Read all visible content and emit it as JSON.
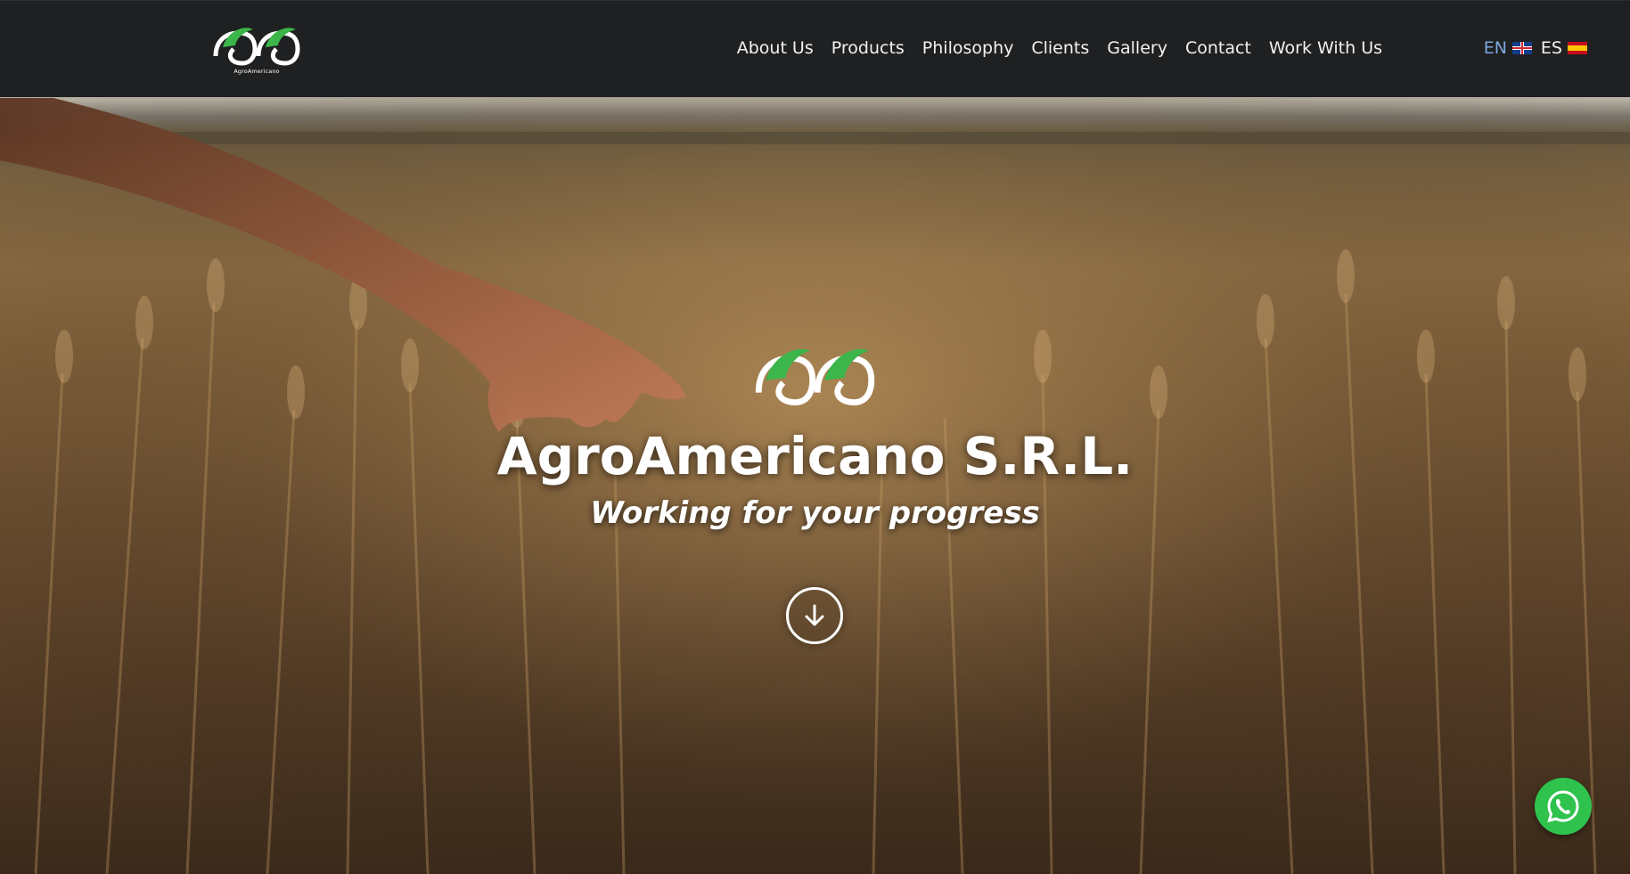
{
  "brand": {
    "name": "AgroAmericano",
    "small_logo_text": "AgroAmericano",
    "accent_green": "#3cb54a"
  },
  "nav": {
    "items": [
      {
        "label": "About Us"
      },
      {
        "label": "Products"
      },
      {
        "label": "Philosophy"
      },
      {
        "label": "Clients"
      },
      {
        "label": "Gallery"
      },
      {
        "label": "Contact"
      },
      {
        "label": "Work With Us"
      }
    ]
  },
  "language": {
    "options": [
      {
        "code": "EN",
        "flag": "uk-flag-icon",
        "active": true
      },
      {
        "code": "ES",
        "flag": "spain-flag-icon",
        "active": false
      }
    ]
  },
  "hero": {
    "title": "AgroAmericano S.R.L.",
    "tagline": "Working for your progress",
    "scroll_icon": "arrow-down-circle-icon",
    "background": "wheat field at sunset with hand brushing wheat"
  },
  "floating": {
    "whatsapp_icon": "whatsapp-icon",
    "whatsapp_color": "#2fc24d"
  }
}
